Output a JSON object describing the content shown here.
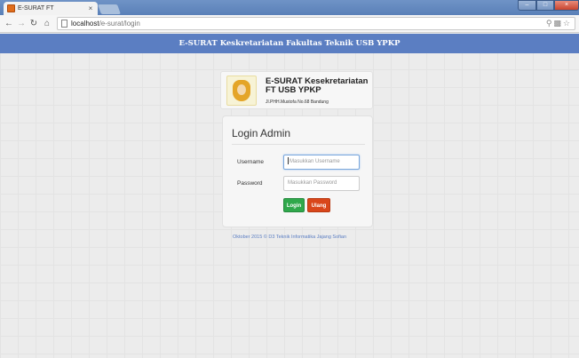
{
  "browser": {
    "tab_title": "E-SURAT FT",
    "tab_close": "×",
    "url_host": "localhost",
    "url_path": "/e-surat/login",
    "icons": [
      "back-icon",
      "forward-icon",
      "reload-icon",
      "home-icon",
      "page-icon",
      "translate-icon",
      "bookmark-star-icon"
    ],
    "minimize": "–",
    "maximize": "□",
    "close": "×"
  },
  "navbar": {
    "title": "E-SURAT Keskretariatan Fakultas Teknik USB YPKP"
  },
  "brand": {
    "title": "E-SURAT Kesekretariatan FT USB YPKP",
    "address": "Jl.PHH.Mustofa No.68 Bandung"
  },
  "login": {
    "heading": "Login Admin",
    "username_label": "Username",
    "username_placeholder": "Masukkan Username",
    "password_label": "Password",
    "password_placeholder": "Masukkan Password",
    "login_button": "Login",
    "reset_button": "Ulang"
  },
  "footer": {
    "text": "Oktober 2015 © D3 Teknik Informatika Jajang Sofian"
  },
  "colors": {
    "navbar": "#5b7ec2",
    "login_button": "#2fa84b",
    "reset_button": "#d9461a"
  }
}
